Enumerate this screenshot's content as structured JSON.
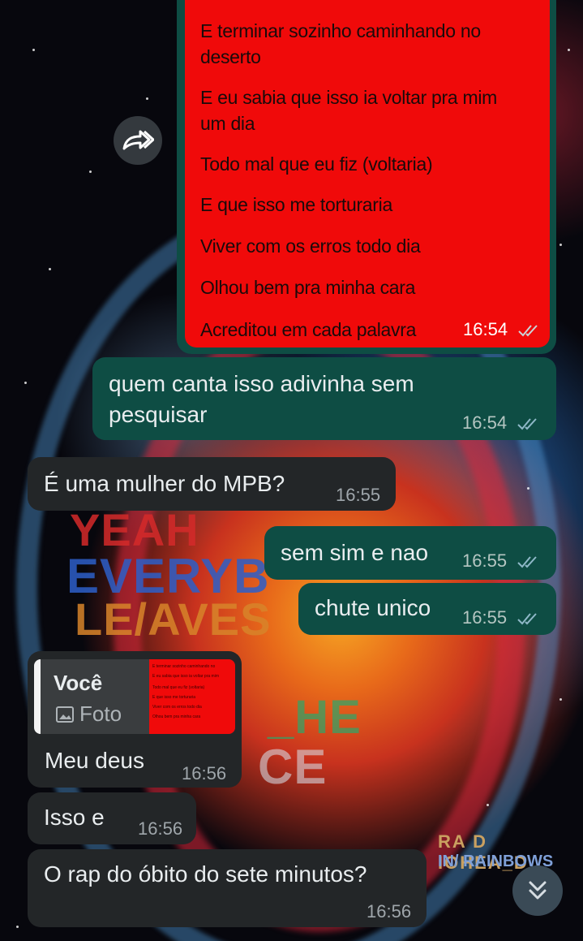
{
  "image_message": {
    "lyrics": [
      "E terminar sozinho caminhando no",
      "deserto",
      "E eu sabia que isso ia voltar pra mim",
      "um dia",
      "Todo mal que eu fiz (voltaria)",
      "E que isso me torturaria",
      "Viver com os erros todo dia",
      "Olhou bem pra minha cara",
      "Acreditou em cada palavra"
    ],
    "time": "16:54"
  },
  "messages": [
    {
      "line1": "quem canta isso adivinha sem",
      "line2": "pesquisar",
      "time": "16:54"
    },
    {
      "text": "É uma mulher do MPB?",
      "time": "16:55"
    },
    {
      "text": "sem sim e nao",
      "time": "16:55"
    },
    {
      "text": "chute unico",
      "time": "16:55"
    },
    {
      "text": "Meu deus",
      "time": "16:56"
    },
    {
      "text": "Isso e",
      "time": "16:56"
    },
    {
      "text": "O rap do óbito do sete minutos?",
      "time": "16:56"
    }
  ],
  "reply_preview": {
    "name": "Você",
    "type": "Foto",
    "thumb_colors": [
      "#f00a0a"
    ]
  },
  "wallpaper": {
    "lines": [
      "YEAH",
      "EVERYB",
      "LE/AVES",
      "_HE",
      "CE"
    ],
    "brand1": "RA D IOHEA_D",
    "brand2": "IN/ RAINBOWS"
  },
  "colors": {
    "outgoing": "#0e4d44",
    "incoming": "#232628",
    "image": "#f00a0a",
    "ticks": "#8fb8c8"
  },
  "icons": {
    "forward": "forward-icon",
    "scroll": "double-chevron-down-icon",
    "photo": "photo-icon",
    "read": "double-check-icon"
  }
}
